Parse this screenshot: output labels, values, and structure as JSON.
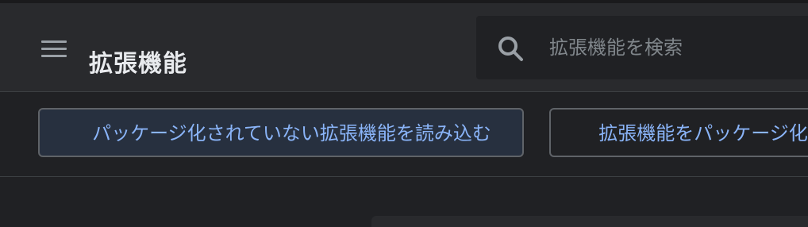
{
  "header": {
    "menu_icon": "hamburger-menu-icon",
    "title": "拡張機能",
    "search": {
      "icon": "search-icon",
      "placeholder": "拡張機能を検索",
      "value": ""
    }
  },
  "toolbar": {
    "load_unpacked_label": "パッケージ化されていない拡張機能を読み込む",
    "pack_extension_label": "拡張機能をパッケージ化"
  },
  "colors": {
    "page_background": "#202124",
    "header_background": "#292a2d",
    "title_text": "#e8eaed",
    "button_text": "#8ab4f8",
    "button_border": "#5f6368",
    "primary_button_background": "#27303f"
  }
}
